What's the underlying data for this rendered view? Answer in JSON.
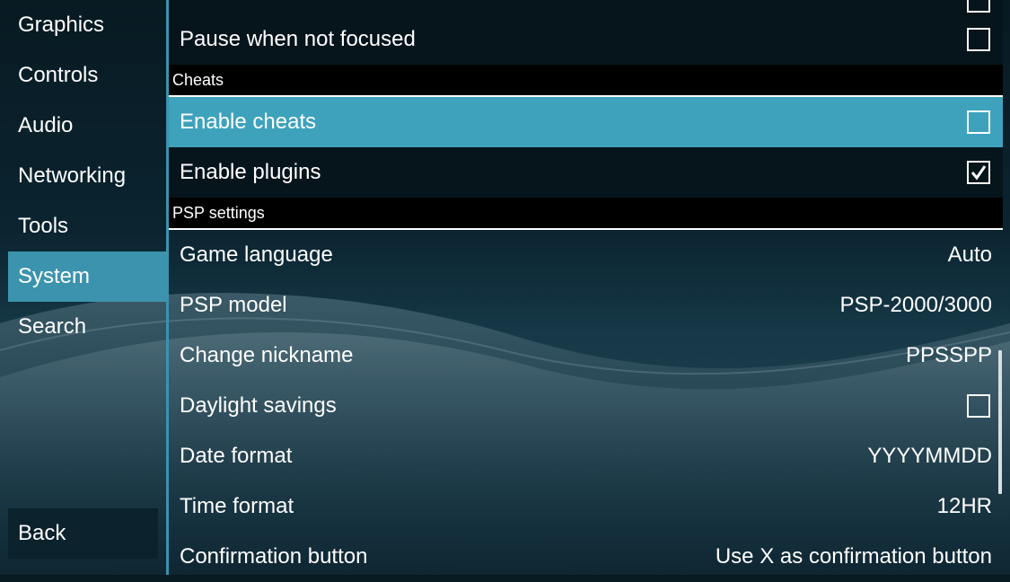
{
  "sidebar": {
    "items": [
      {
        "label": "Graphics"
      },
      {
        "label": "Controls"
      },
      {
        "label": "Audio"
      },
      {
        "label": "Networking"
      },
      {
        "label": "Tools"
      },
      {
        "label": "System",
        "active": true
      },
      {
        "label": "Search"
      }
    ],
    "back_label": "Back"
  },
  "settings": {
    "pause_when_not_focused": {
      "label": "Pause when not focused",
      "checked": false
    },
    "cheats_header": "Cheats",
    "enable_cheats": {
      "label": "Enable cheats",
      "checked": false
    },
    "enable_plugins": {
      "label": "Enable plugins",
      "checked": true
    },
    "psp_header": "PSP settings",
    "game_language": {
      "label": "Game language",
      "value": "Auto"
    },
    "psp_model": {
      "label": "PSP model",
      "value": "PSP-2000/3000"
    },
    "change_nickname": {
      "label": "Change nickname",
      "value": "PPSSPP"
    },
    "daylight_savings": {
      "label": "Daylight savings",
      "checked": false
    },
    "date_format": {
      "label": "Date format",
      "value": "YYYYMMDD"
    },
    "time_format": {
      "label": "Time format",
      "value": "12HR"
    },
    "confirmation_button": {
      "label": "Confirmation button",
      "value": "Use X as confirmation button"
    }
  },
  "colors": {
    "accent": "#3c93ad",
    "focused_row": "#3ea2bd",
    "row_bg": "#06141b",
    "header_bg": "#000000"
  },
  "icons": {
    "checkbox": "checkbox-icon",
    "checkmark": "checkmark-icon"
  }
}
